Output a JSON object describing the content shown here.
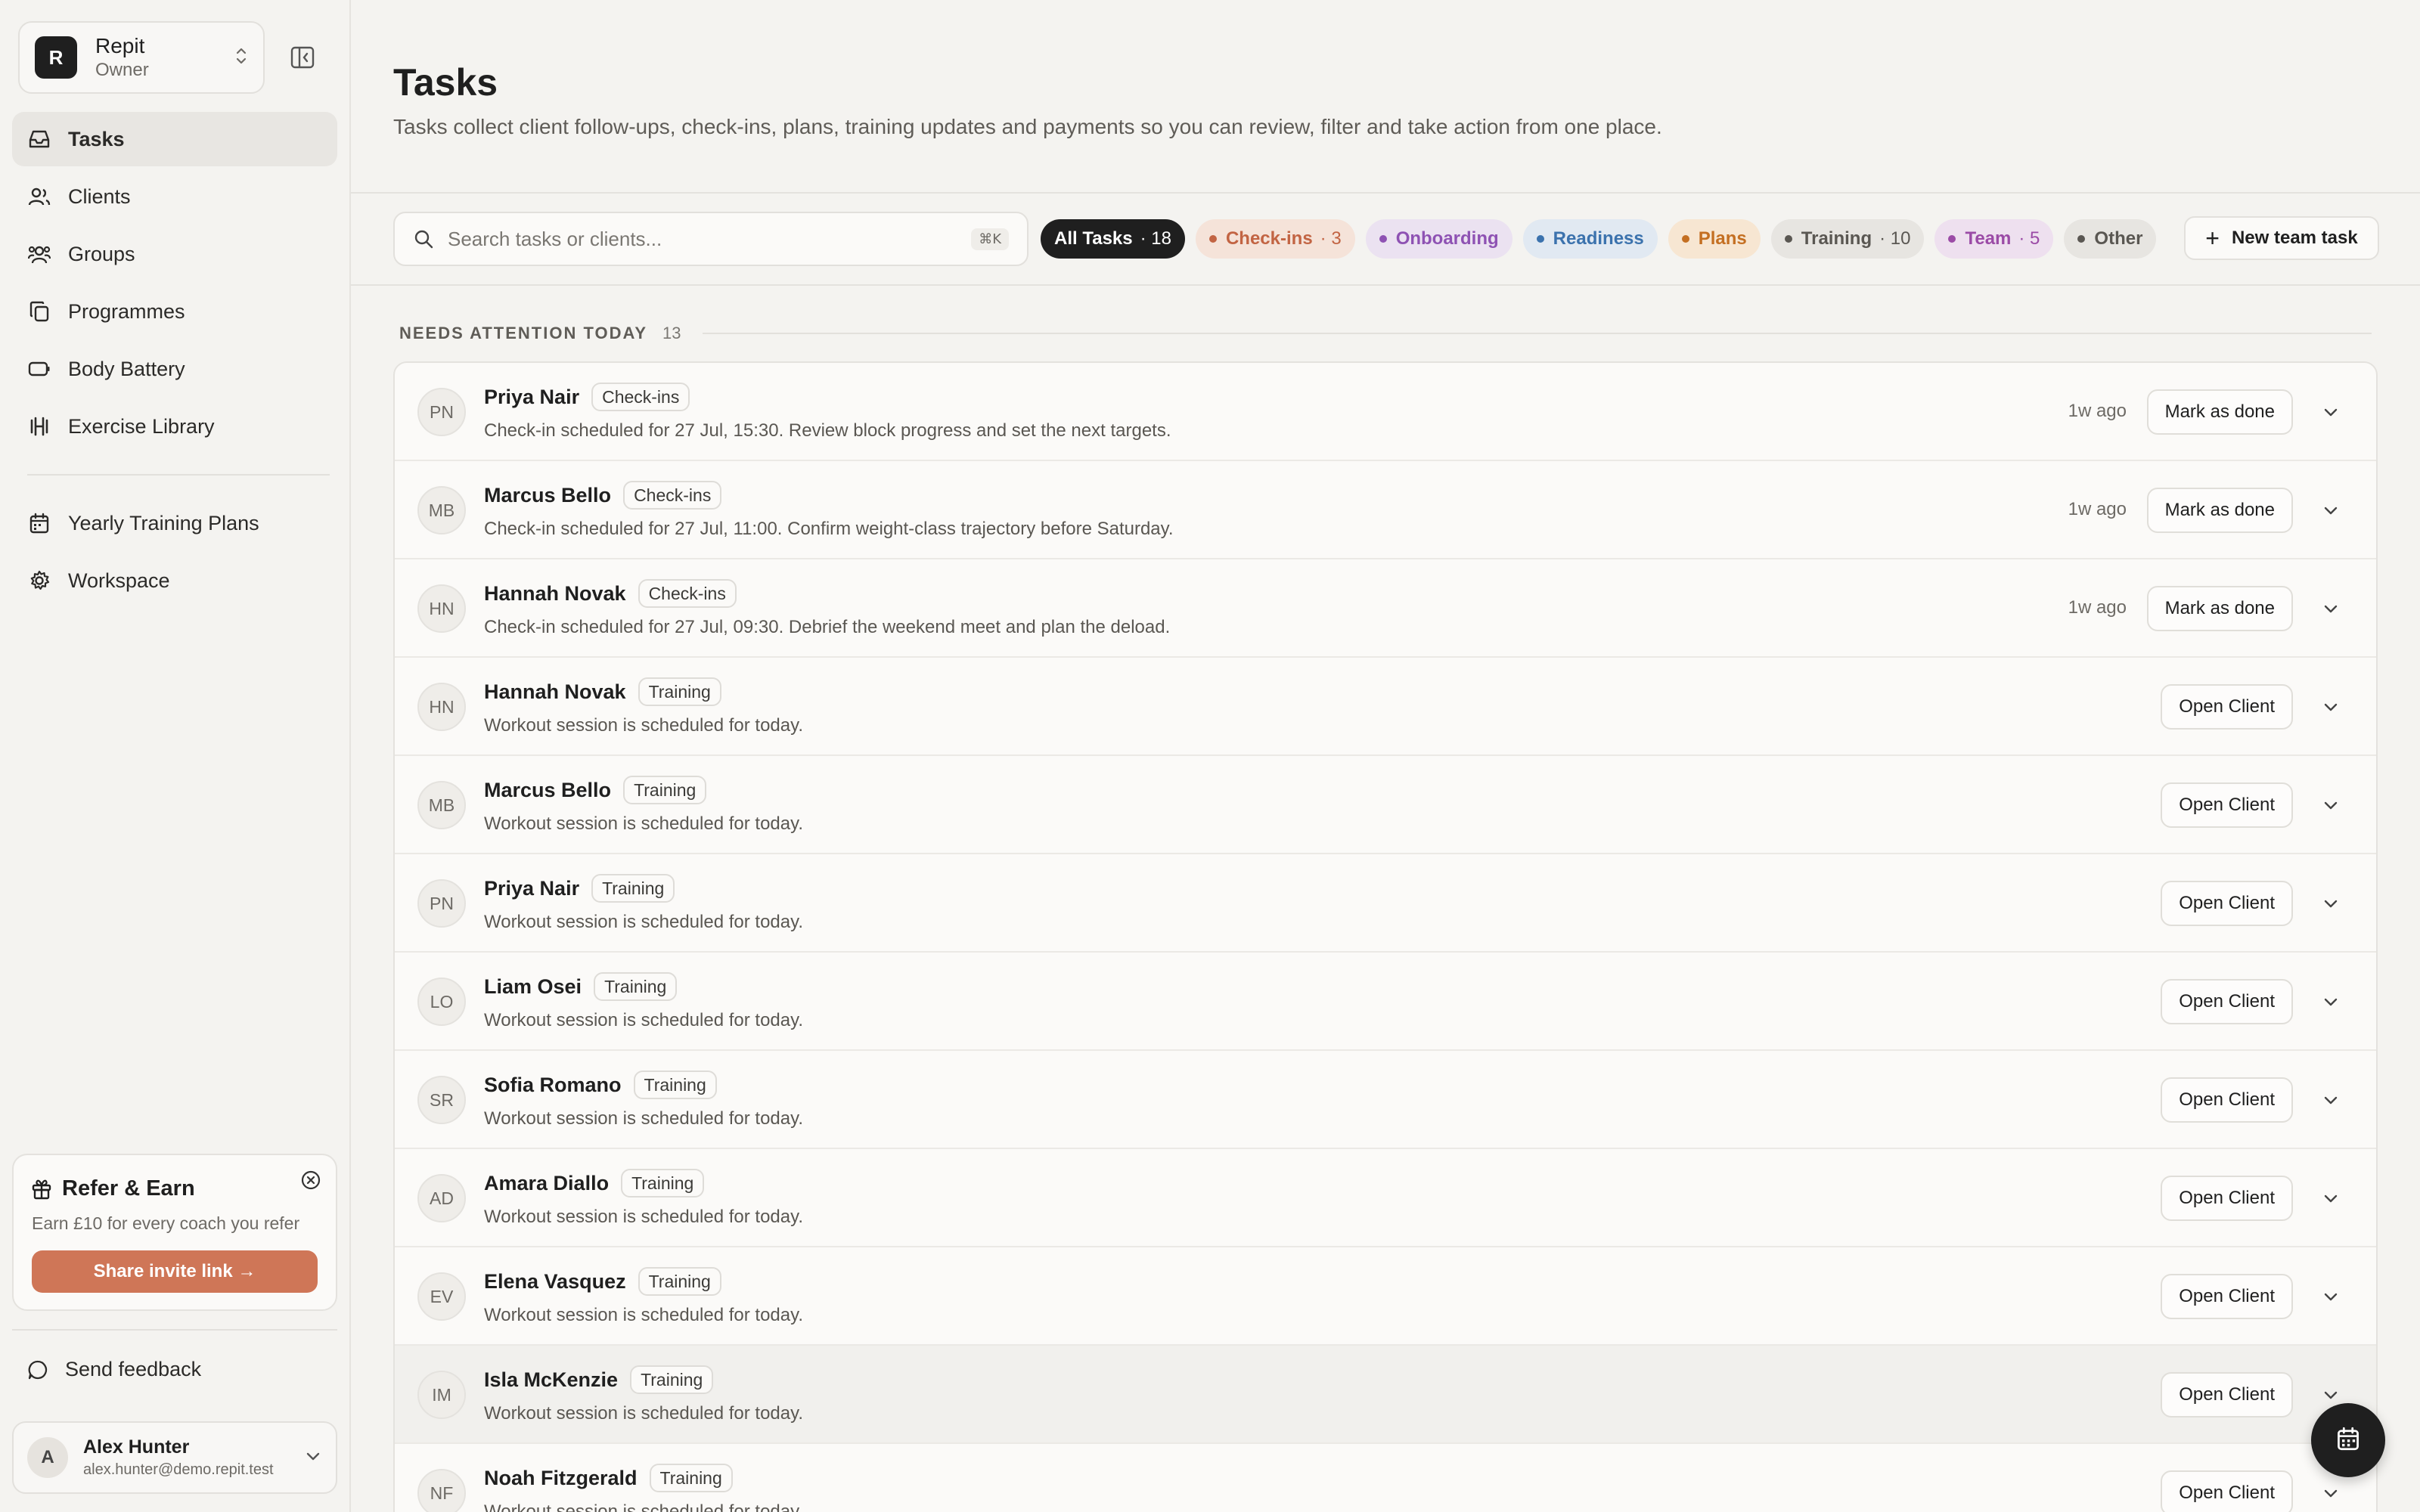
{
  "workspace": {
    "logo": "R",
    "name": "Repit",
    "role": "Owner"
  },
  "nav": {
    "primary": [
      {
        "label": "Tasks",
        "icon": "inbox-icon",
        "active": true
      },
      {
        "label": "Clients",
        "icon": "users-icon"
      },
      {
        "label": "Groups",
        "icon": "group-icon"
      },
      {
        "label": "Programmes",
        "icon": "copy-icon"
      },
      {
        "label": "Body Battery",
        "icon": "battery-icon"
      },
      {
        "label": "Exercise Library",
        "icon": "dumbbell-icon"
      }
    ],
    "secondary": [
      {
        "label": "Yearly Training Plans",
        "icon": "calendar-icon"
      },
      {
        "label": "Workspace",
        "icon": "gear-icon"
      }
    ]
  },
  "refer": {
    "title": "Refer & Earn",
    "subtitle": "Earn £10 for every coach you refer",
    "button": "Share invite link →"
  },
  "feedback": {
    "label": "Send feedback"
  },
  "user": {
    "initial": "A",
    "name": "Alex Hunter",
    "email": "alex.hunter@demo.repit.test"
  },
  "page": {
    "title": "Tasks",
    "subtitle": "Tasks collect client follow-ups, check-ins, plans, training updates and payments so you can review, filter and take action from one place."
  },
  "search": {
    "placeholder": "Search tasks or clients...",
    "shortcut": "⌘K"
  },
  "filters": {
    "all": {
      "label": "All Tasks",
      "count": "· 18"
    },
    "checkins": {
      "label": "Check-ins",
      "count": "· 3"
    },
    "onboarding": {
      "label": "Onboarding"
    },
    "readiness": {
      "label": "Readiness"
    },
    "plans": {
      "label": "Plans"
    },
    "training": {
      "label": "Training",
      "count": "· 10"
    },
    "team": {
      "label": "Team",
      "count": "· 5"
    },
    "other": {
      "label": "Other"
    }
  },
  "new_task_label": "New team task",
  "section": {
    "label": "NEEDS ATTENTION TODAY",
    "count": "13"
  },
  "tasks": [
    {
      "initials": "PN",
      "name": "Priya Nair",
      "tag": "Check-ins",
      "desc": "Check-in scheduled for 27 Jul, 15:30. Review block progress and set the next targets.",
      "time": "1w ago",
      "action": "Mark as done"
    },
    {
      "initials": "MB",
      "name": "Marcus Bello",
      "tag": "Check-ins",
      "desc": "Check-in scheduled for 27 Jul, 11:00. Confirm weight-class trajectory before Saturday.",
      "time": "1w ago",
      "action": "Mark as done"
    },
    {
      "initials": "HN",
      "name": "Hannah Novak",
      "tag": "Check-ins",
      "desc": "Check-in scheduled for 27 Jul, 09:30. Debrief the weekend meet and plan the deload.",
      "time": "1w ago",
      "action": "Mark as done"
    },
    {
      "initials": "HN",
      "name": "Hannah Novak",
      "tag": "Training",
      "desc": "Workout session is scheduled for today.",
      "time": "",
      "action": "Open Client"
    },
    {
      "initials": "MB",
      "name": "Marcus Bello",
      "tag": "Training",
      "desc": "Workout session is scheduled for today.",
      "time": "",
      "action": "Open Client"
    },
    {
      "initials": "PN",
      "name": "Priya Nair",
      "tag": "Training",
      "desc": "Workout session is scheduled for today.",
      "time": "",
      "action": "Open Client"
    },
    {
      "initials": "LO",
      "name": "Liam Osei",
      "tag": "Training",
      "desc": "Workout session is scheduled for today.",
      "time": "",
      "action": "Open Client"
    },
    {
      "initials": "SR",
      "name": "Sofia Romano",
      "tag": "Training",
      "desc": "Workout session is scheduled for today.",
      "time": "",
      "action": "Open Client"
    },
    {
      "initials": "AD",
      "name": "Amara Diallo",
      "tag": "Training",
      "desc": "Workout session is scheduled for today.",
      "time": "",
      "action": "Open Client"
    },
    {
      "initials": "EV",
      "name": "Elena Vasquez",
      "tag": "Training",
      "desc": "Workout session is scheduled for today.",
      "time": "",
      "action": "Open Client"
    },
    {
      "initials": "IM",
      "name": "Isla McKenzie",
      "tag": "Training",
      "desc": "Workout session is scheduled for today.",
      "time": "",
      "action": "Open Client"
    },
    {
      "initials": "NF",
      "name": "Noah Fitzgerald",
      "tag": "Training",
      "desc": "Workout session is scheduled for today.",
      "time": "",
      "action": "Open Client"
    }
  ],
  "fab_icon": "calendar-icon"
}
